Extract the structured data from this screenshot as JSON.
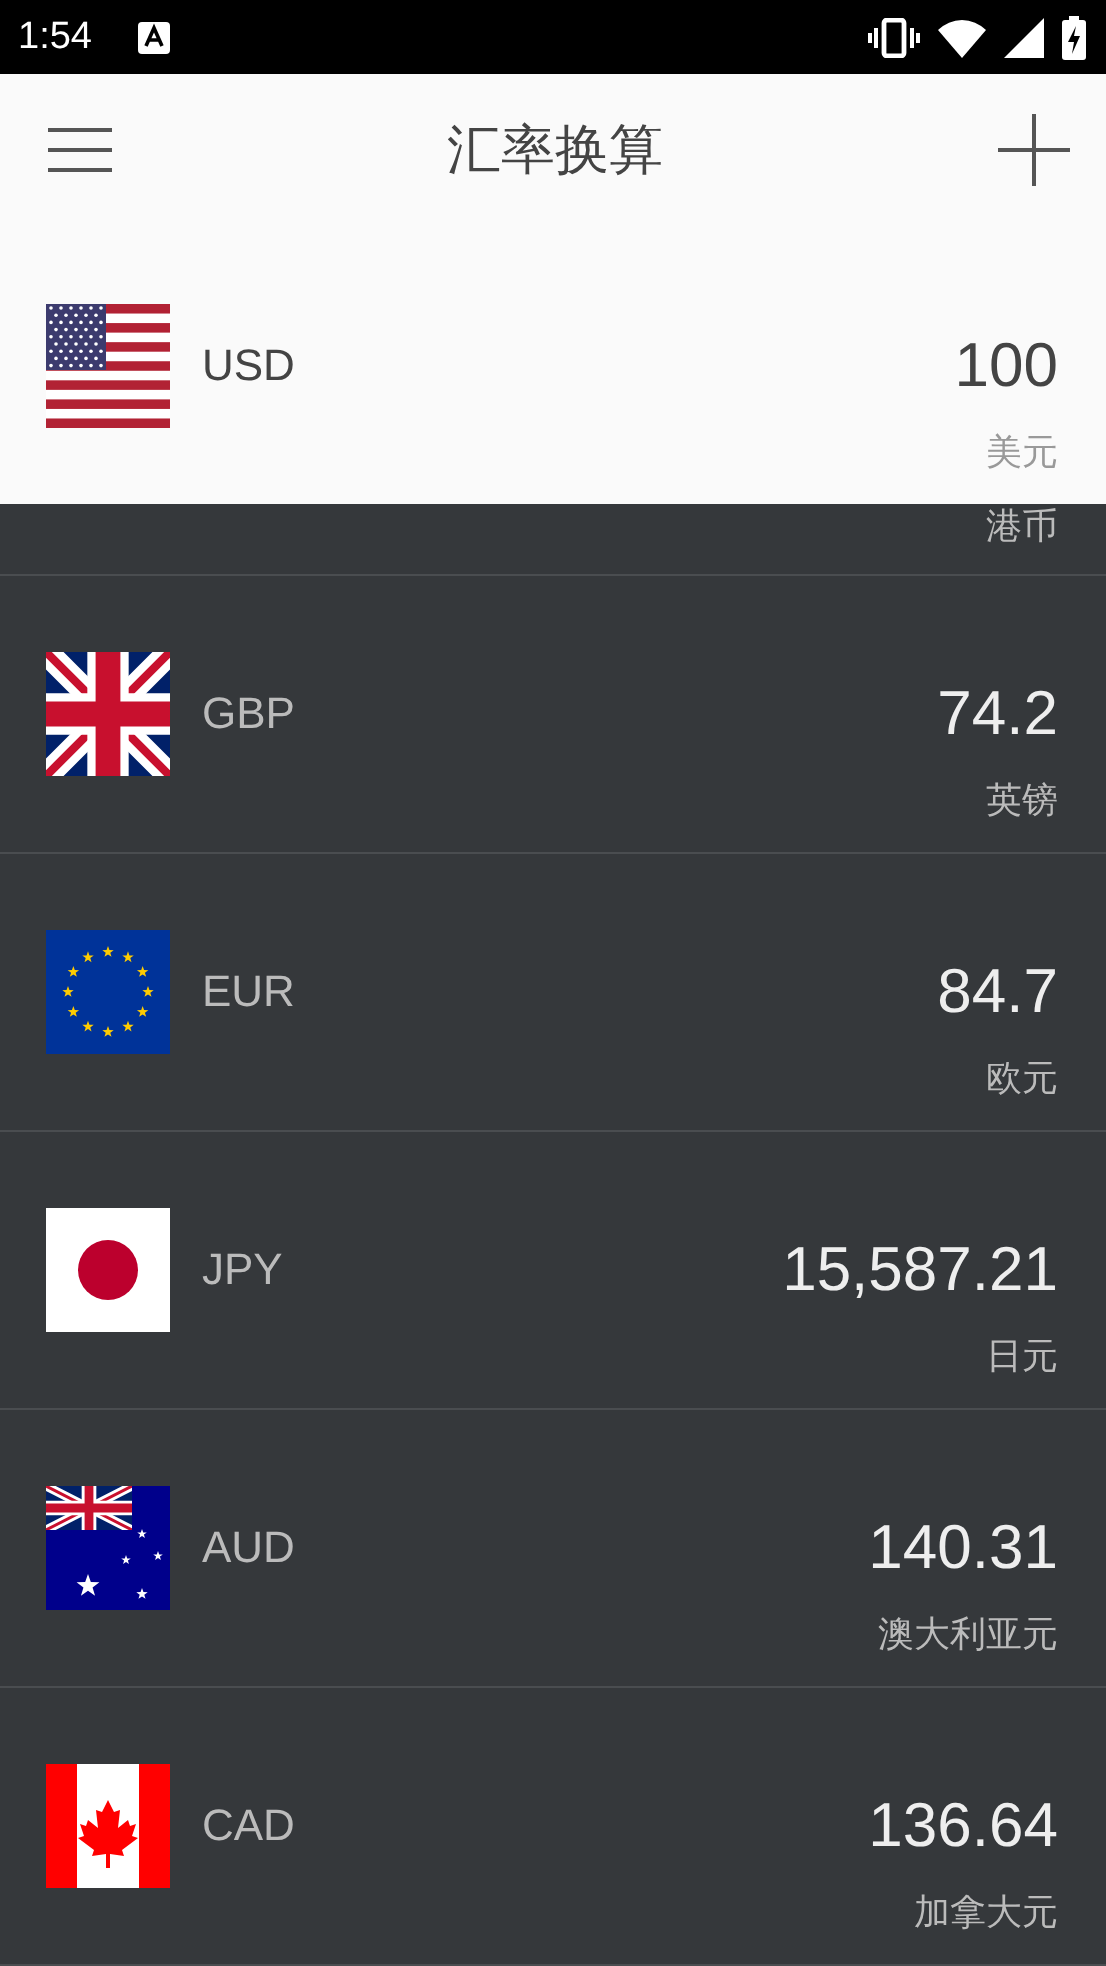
{
  "status_bar": {
    "time": "1:54"
  },
  "toolbar": {
    "title": "汇率换算"
  },
  "base_currency": {
    "kind": "us",
    "code": "USD",
    "amount": "100",
    "name": "美元"
  },
  "partial_row": {
    "name": "港币"
  },
  "currencies": [
    {
      "kind": "gb",
      "code": "GBP",
      "amount": "74.2",
      "name": "英镑"
    },
    {
      "kind": "eu",
      "code": "EUR",
      "amount": "84.7",
      "name": "欧元"
    },
    {
      "kind": "jp",
      "code": "JPY",
      "amount": "15,587.21",
      "name": "日元"
    },
    {
      "kind": "au",
      "code": "AUD",
      "amount": "140.31",
      "name": "澳大利亚元"
    },
    {
      "kind": "ca",
      "code": "CAD",
      "amount": "136.64",
      "name": "加拿大元"
    }
  ]
}
